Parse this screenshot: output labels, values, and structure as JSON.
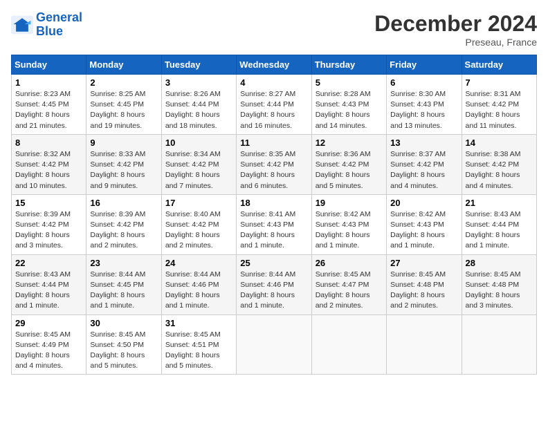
{
  "logo": {
    "line1": "General",
    "line2": "Blue"
  },
  "title": "December 2024",
  "subtitle": "Preseau, France",
  "days_header": [
    "Sunday",
    "Monday",
    "Tuesday",
    "Wednesday",
    "Thursday",
    "Friday",
    "Saturday"
  ],
  "weeks": [
    [
      {
        "day": "1",
        "info": "Sunrise: 8:23 AM\nSunset: 4:45 PM\nDaylight: 8 hours\nand 21 minutes."
      },
      {
        "day": "2",
        "info": "Sunrise: 8:25 AM\nSunset: 4:45 PM\nDaylight: 8 hours\nand 19 minutes."
      },
      {
        "day": "3",
        "info": "Sunrise: 8:26 AM\nSunset: 4:44 PM\nDaylight: 8 hours\nand 18 minutes."
      },
      {
        "day": "4",
        "info": "Sunrise: 8:27 AM\nSunset: 4:44 PM\nDaylight: 8 hours\nand 16 minutes."
      },
      {
        "day": "5",
        "info": "Sunrise: 8:28 AM\nSunset: 4:43 PM\nDaylight: 8 hours\nand 14 minutes."
      },
      {
        "day": "6",
        "info": "Sunrise: 8:30 AM\nSunset: 4:43 PM\nDaylight: 8 hours\nand 13 minutes."
      },
      {
        "day": "7",
        "info": "Sunrise: 8:31 AM\nSunset: 4:42 PM\nDaylight: 8 hours\nand 11 minutes."
      }
    ],
    [
      {
        "day": "8",
        "info": "Sunrise: 8:32 AM\nSunset: 4:42 PM\nDaylight: 8 hours\nand 10 minutes."
      },
      {
        "day": "9",
        "info": "Sunrise: 8:33 AM\nSunset: 4:42 PM\nDaylight: 8 hours\nand 9 minutes."
      },
      {
        "day": "10",
        "info": "Sunrise: 8:34 AM\nSunset: 4:42 PM\nDaylight: 8 hours\nand 7 minutes."
      },
      {
        "day": "11",
        "info": "Sunrise: 8:35 AM\nSunset: 4:42 PM\nDaylight: 8 hours\nand 6 minutes."
      },
      {
        "day": "12",
        "info": "Sunrise: 8:36 AM\nSunset: 4:42 PM\nDaylight: 8 hours\nand 5 minutes."
      },
      {
        "day": "13",
        "info": "Sunrise: 8:37 AM\nSunset: 4:42 PM\nDaylight: 8 hours\nand 4 minutes."
      },
      {
        "day": "14",
        "info": "Sunrise: 8:38 AM\nSunset: 4:42 PM\nDaylight: 8 hours\nand 4 minutes."
      }
    ],
    [
      {
        "day": "15",
        "info": "Sunrise: 8:39 AM\nSunset: 4:42 PM\nDaylight: 8 hours\nand 3 minutes."
      },
      {
        "day": "16",
        "info": "Sunrise: 8:39 AM\nSunset: 4:42 PM\nDaylight: 8 hours\nand 2 minutes."
      },
      {
        "day": "17",
        "info": "Sunrise: 8:40 AM\nSunset: 4:42 PM\nDaylight: 8 hours\nand 2 minutes."
      },
      {
        "day": "18",
        "info": "Sunrise: 8:41 AM\nSunset: 4:43 PM\nDaylight: 8 hours\nand 1 minute."
      },
      {
        "day": "19",
        "info": "Sunrise: 8:42 AM\nSunset: 4:43 PM\nDaylight: 8 hours\nand 1 minute."
      },
      {
        "day": "20",
        "info": "Sunrise: 8:42 AM\nSunset: 4:43 PM\nDaylight: 8 hours\nand 1 minute."
      },
      {
        "day": "21",
        "info": "Sunrise: 8:43 AM\nSunset: 4:44 PM\nDaylight: 8 hours\nand 1 minute."
      }
    ],
    [
      {
        "day": "22",
        "info": "Sunrise: 8:43 AM\nSunset: 4:44 PM\nDaylight: 8 hours\nand 1 minute."
      },
      {
        "day": "23",
        "info": "Sunrise: 8:44 AM\nSunset: 4:45 PM\nDaylight: 8 hours\nand 1 minute."
      },
      {
        "day": "24",
        "info": "Sunrise: 8:44 AM\nSunset: 4:46 PM\nDaylight: 8 hours\nand 1 minute."
      },
      {
        "day": "25",
        "info": "Sunrise: 8:44 AM\nSunset: 4:46 PM\nDaylight: 8 hours\nand 1 minute."
      },
      {
        "day": "26",
        "info": "Sunrise: 8:45 AM\nSunset: 4:47 PM\nDaylight: 8 hours\nand 2 minutes."
      },
      {
        "day": "27",
        "info": "Sunrise: 8:45 AM\nSunset: 4:48 PM\nDaylight: 8 hours\nand 2 minutes."
      },
      {
        "day": "28",
        "info": "Sunrise: 8:45 AM\nSunset: 4:48 PM\nDaylight: 8 hours\nand 3 minutes."
      }
    ],
    [
      {
        "day": "29",
        "info": "Sunrise: 8:45 AM\nSunset: 4:49 PM\nDaylight: 8 hours\nand 4 minutes."
      },
      {
        "day": "30",
        "info": "Sunrise: 8:45 AM\nSunset: 4:50 PM\nDaylight: 8 hours\nand 5 minutes."
      },
      {
        "day": "31",
        "info": "Sunrise: 8:45 AM\nSunset: 4:51 PM\nDaylight: 8 hours\nand 5 minutes."
      },
      null,
      null,
      null,
      null
    ]
  ]
}
